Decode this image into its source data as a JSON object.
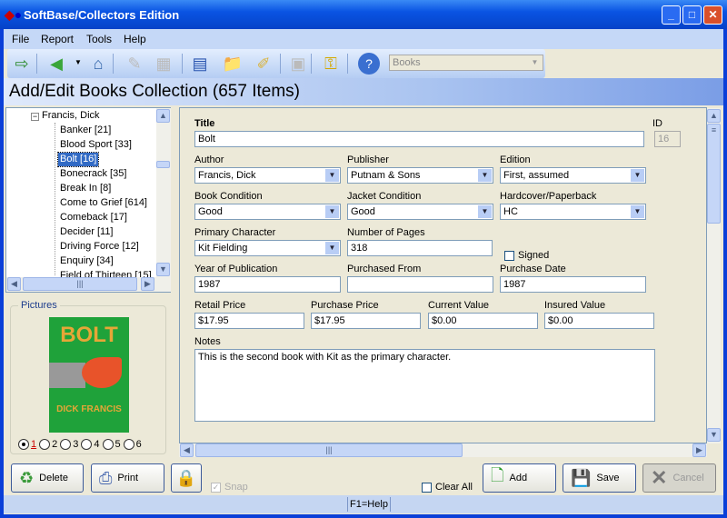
{
  "window": {
    "title": "SoftBase/Collectors Edition"
  },
  "menu": [
    "File",
    "Report",
    "Tools",
    "Help"
  ],
  "toolbar": {
    "combo_value": "Books",
    "icons": [
      "exit-icon",
      "back-icon",
      "home-icon",
      "edit-icon",
      "search-grid-icon",
      "list-view-icon",
      "add-folder-icon",
      "edit-folder-icon",
      "save-disk-icon",
      "key-icon",
      "help-icon"
    ]
  },
  "header": {
    "title": "Add/Edit Books Collection (657 Items)"
  },
  "tree": {
    "parent": "Francis, Dick",
    "items": [
      "Banker [21]",
      "Blood Sport [33]",
      "Bolt [16]",
      "Bonecrack [35]",
      "Break In [8]",
      "Come to Grief [614]",
      "Comeback [17]",
      "Decider [11]",
      "Driving Force [12]",
      "Enquiry [34]",
      "Field of Thirteen [15]"
    ],
    "selected": "Bolt [16]"
  },
  "pictures": {
    "label": "Pictures",
    "cover_title": "BOLT",
    "cover_author": "DICK FRANCIS",
    "radios": [
      "1",
      "2",
      "3",
      "4",
      "5",
      "6"
    ],
    "selected": "1"
  },
  "form": {
    "title": {
      "label": "Title",
      "value": "Bolt"
    },
    "id": {
      "label": "ID",
      "value": "16"
    },
    "author": {
      "label": "Author",
      "value": "Francis, Dick"
    },
    "publisher": {
      "label": "Publisher",
      "value": "Putnam & Sons"
    },
    "edition": {
      "label": "Edition",
      "value": "First, assumed"
    },
    "book_condition": {
      "label": "Book Condition",
      "value": "Good"
    },
    "jacket_condition": {
      "label": "Jacket Condition",
      "value": "Good"
    },
    "cover": {
      "label": "Hardcover/Paperback",
      "value": "HC"
    },
    "primary_character": {
      "label": "Primary Character",
      "value": "Kit Fielding"
    },
    "pages": {
      "label": "Number of Pages",
      "value": "318"
    },
    "signed": {
      "label": "Signed",
      "checked": false
    },
    "year": {
      "label": "Year of Publication",
      "value": "1987"
    },
    "purchased_from": {
      "label": "Purchased From",
      "value": ""
    },
    "purchase_date": {
      "label": "Purchase Date",
      "value": "1987"
    },
    "retail_price": {
      "label": "Retail Price",
      "value": "$17.95"
    },
    "purchase_price": {
      "label": "Purchase Price",
      "value": "$17.95"
    },
    "current_value": {
      "label": "Current Value",
      "value": "$0.00"
    },
    "insured_value": {
      "label": "Insured Value",
      "value": "$0.00"
    },
    "notes": {
      "label": "Notes",
      "value": "This is the second book with Kit as the primary character."
    }
  },
  "buttons": {
    "delete": "Delete",
    "print": "Print",
    "snap": "Snap",
    "clear_all": "Clear All",
    "add": "Add",
    "save": "Save",
    "cancel": "Cancel"
  },
  "status": {
    "help": "F1=Help"
  }
}
